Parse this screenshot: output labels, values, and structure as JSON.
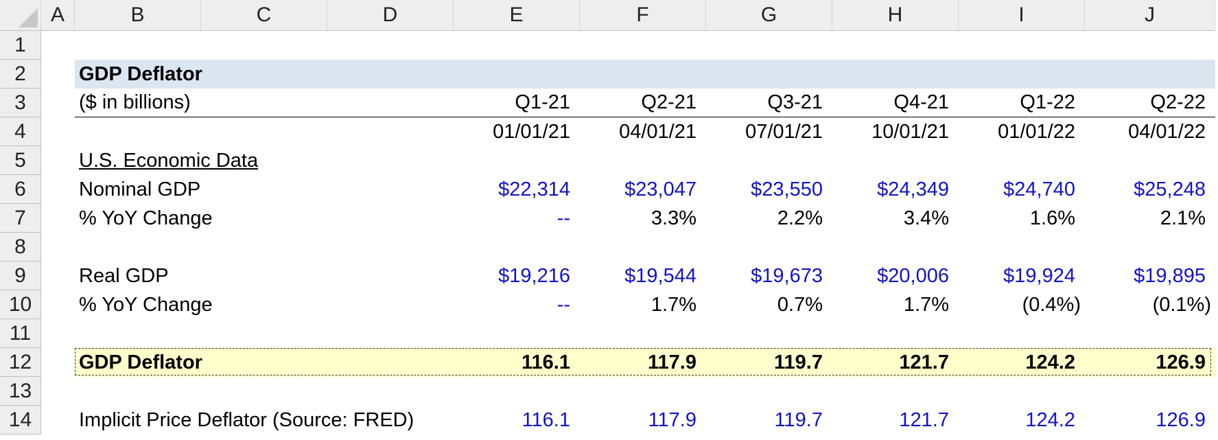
{
  "column_headers": [
    "A",
    "B",
    "C",
    "D",
    "E",
    "F",
    "G",
    "H",
    "I",
    "J"
  ],
  "row_numbers": [
    "1",
    "2",
    "3",
    "4",
    "5",
    "6",
    "7",
    "8",
    "9",
    "10",
    "11",
    "12",
    "13",
    "14"
  ],
  "title": "GDP Deflator",
  "units": "($ in billions)",
  "periods": [
    "Q1-21",
    "Q2-21",
    "Q3-21",
    "Q4-21",
    "Q1-22",
    "Q2-22"
  ],
  "dates": [
    "01/01/21",
    "04/01/21",
    "07/01/21",
    "10/01/21",
    "01/01/22",
    "04/01/22"
  ],
  "section_label": "U.S. Economic Data",
  "nominal_gdp": {
    "label": "Nominal GDP",
    "values": [
      "$22,314",
      "$23,047",
      "$23,550",
      "$24,349",
      "$24,740",
      "$25,248"
    ]
  },
  "nominal_yoy": {
    "label": "% YoY Change",
    "values": [
      "--",
      "3.3%",
      "2.2%",
      "3.4%",
      "1.6%",
      "2.1%"
    ]
  },
  "real_gdp": {
    "label": "Real GDP",
    "values": [
      "$19,216",
      "$19,544",
      "$19,673",
      "$20,006",
      "$19,924",
      "$19,895"
    ]
  },
  "real_yoy": {
    "label": "% YoY Change",
    "values": [
      "--",
      "1.7%",
      "0.7%",
      "1.7%",
      "(0.4%)",
      "(0.1%)"
    ]
  },
  "gdp_deflator": {
    "label": "GDP Deflator",
    "values": [
      "116.1",
      "117.9",
      "119.7",
      "121.7",
      "124.2",
      "126.9"
    ]
  },
  "implicit_deflator": {
    "label": "Implicit Price Deflator (Source: FRED)",
    "values": [
      "116.1",
      "117.9",
      "119.7",
      "121.7",
      "124.2",
      "126.9"
    ]
  },
  "colors": {
    "input_blue": "#1212cc",
    "title_band": "#dce6f1",
    "highlight_band": "#ffffcc",
    "header_gray": "#eeeeee"
  }
}
